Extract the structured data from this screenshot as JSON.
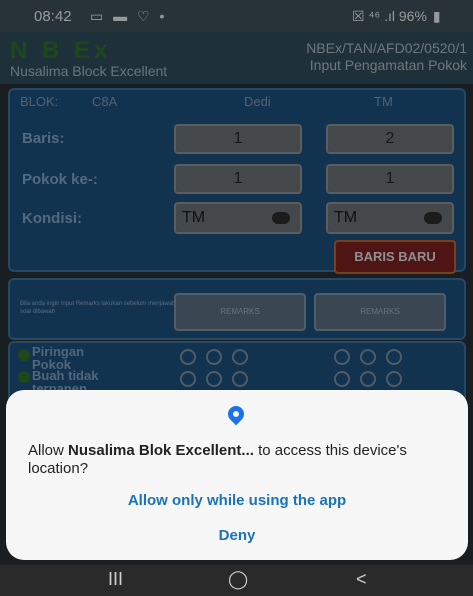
{
  "status": {
    "time": "08:42",
    "icons": "▭ ▬ ♡ •",
    "right": "☒ ⁴⁶ .ıl 96%",
    "battery_icon": "▮"
  },
  "app": {
    "logo": "N B Ex",
    "name": "Nusalima Block Excellent",
    "code_line1": "NBEx/TAN/AFD02/0520/1",
    "code_line2": "Input Pengamatan Pokok"
  },
  "header": {
    "blok_label": "BLOK:",
    "blok_value": "C8A",
    "person": "Dedi",
    "status": "TM"
  },
  "form": {
    "baris_label": "Baris:",
    "baris_values": [
      "1",
      "2"
    ],
    "pokok_label": "Pokok ke-:",
    "pokok_values": [
      "1",
      "1"
    ],
    "kondisi_label": "Kondisi:",
    "kondisi_values": [
      "TM",
      "TM"
    ],
    "baris_baru_button": "BARIS BARU"
  },
  "remarks": {
    "note": "Bila anda ingin input Remarks lakukan sebelum menjawab soal dibawah",
    "button_labels": [
      "REMARKS",
      "REMARKS"
    ]
  },
  "questions": [
    {
      "line1": "Piringan",
      "line2": "Pokok"
    },
    {
      "line1": "Buah tidak",
      "line2": "terpanen"
    }
  ],
  "dialog": {
    "message_pre": "Allow ",
    "app_name": "Nusalima Blok Excellent...",
    "message_post": " to access this device's location?",
    "allow_button": "Allow only while using the app",
    "deny_button": "Deny"
  },
  "navbar": {
    "recent": "III",
    "home": "◯",
    "back": "<"
  }
}
